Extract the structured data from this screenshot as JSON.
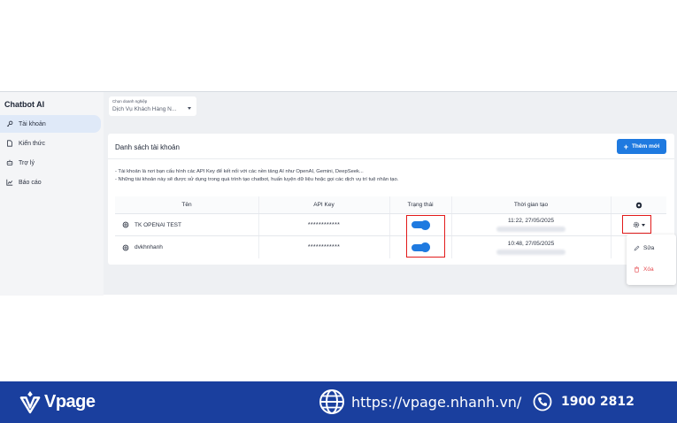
{
  "sidebar": {
    "brand": "Chatbot AI",
    "items": [
      {
        "label": "Tài khoản",
        "icon": "key-icon",
        "active": true
      },
      {
        "label": "Kiến thức",
        "icon": "document-icon",
        "active": false
      },
      {
        "label": "Trợ lý",
        "icon": "assistant-icon",
        "active": false
      },
      {
        "label": "Báo cáo",
        "icon": "chart-icon",
        "active": false
      }
    ]
  },
  "enterprise_select": {
    "label": "Chọn doanh nghiệp",
    "value": "Dịch Vụ Khách Hàng N..."
  },
  "card": {
    "title": "Danh sách tài khoản",
    "add_button": "Thêm mới",
    "descriptions": [
      "- Tài khoản là nơi bạn cấu hình các API Key để kết nối với các nền tảng AI như OpenAI, Gemini, DeepSeek...",
      "- Những tài khoản này sẽ được sử dụng trong quá trình tạo chatbot, huấn luyện dữ liệu hoặc gọi các dịch vụ trí tuệ nhân tạo."
    ]
  },
  "table": {
    "headers": {
      "name": "Tên",
      "api_key": "API Key",
      "status": "Trạng thái",
      "created": "Thời gian tạo",
      "actions_icon": "gear-icon"
    },
    "rows": [
      {
        "name": "TK OPENAI TEST",
        "api_key": "************",
        "status_on": true,
        "created": "11:22, 27/05/2025"
      },
      {
        "name": "dvkhnhanh",
        "api_key": "************",
        "status_on": true,
        "created": "10:48, 27/05/2025"
      }
    ]
  },
  "action_menu": {
    "edit": "Sửa",
    "delete": "Xóa",
    "delete_color": "#e5484d"
  },
  "footer": {
    "brand": "Vpage",
    "url": "https://vpage.nhanh.vn/",
    "phone": "1900 2812",
    "background": "#1a3f9e"
  },
  "colors": {
    "accent": "#1f7ae0",
    "highlight_box": "#e21b1b"
  }
}
